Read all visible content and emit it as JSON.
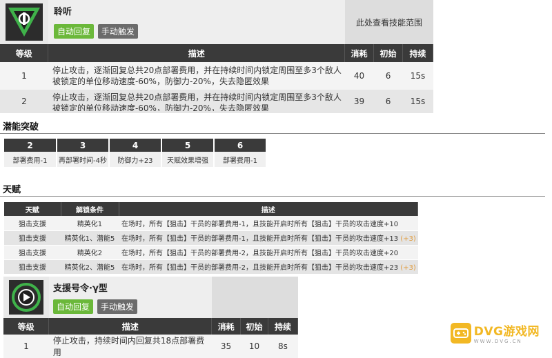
{
  "skill1": {
    "name": "聆听",
    "tags": [
      "自动回复",
      "手动触发"
    ],
    "range_label": "此处查看技能范围",
    "headers": [
      "等级",
      "描述",
      "消耗",
      "初始",
      "持续"
    ],
    "rows": [
      {
        "level": "1",
        "desc": "停止攻击，逐渐回复总共20点部署费用，并在持续时间内锁定周围至多3个敌人 被锁定的单位移动速度-60%，防御力-20%，失去隐匿效果",
        "cost": "40",
        "init": "6",
        "dur": "15s"
      },
      {
        "level": "2",
        "desc": "停止攻击，逐渐回复总共20点部署费用，并在持续时间内锁定周围至多3个敌人 被锁定的单位移动速度-60%，防御力-20%，失去隐匿效果",
        "cost": "39",
        "init": "6",
        "dur": "15s"
      }
    ]
  },
  "potential": {
    "title": "潜能突破",
    "headers": [
      "2",
      "3",
      "4",
      "5",
      "6"
    ],
    "values": [
      "部署费用-1",
      "再部署时间-4秒",
      "防御力+23",
      "天赋效果增强",
      "部署费用-1"
    ]
  },
  "talent": {
    "title": "天赋",
    "headers": [
      "天赋",
      "解锁条件",
      "描述"
    ],
    "rows": [
      {
        "name": "狙击支援",
        "cond": "精英化1",
        "desc": "在场时，所有【狙击】干员的部署费用-1，且技能开启时所有【狙击】干员的攻击速度+10",
        "extra": ""
      },
      {
        "name": "狙击支援",
        "cond": "精英化1、潜能5",
        "desc": "在场时，所有【狙击】干员的部署费用-1，且技能开启时所有【狙击】干员的攻击速度+13",
        "extra": "(+3)"
      },
      {
        "name": "狙击支援",
        "cond": "精英化2",
        "desc": "在场时，所有【狙击】干员的部署费用-2，且技能开启时所有【狙击】干员的攻击速度+20",
        "extra": ""
      },
      {
        "name": "狙击支援",
        "cond": "精英化2、潜能5",
        "desc": "在场时，所有【狙击】干员的部署费用-2，且技能开启时所有【狙击】干员的攻击速度+23",
        "extra": "(+3)"
      }
    ]
  },
  "skill2": {
    "name": "支援号令·γ型",
    "tags": [
      "自动回复",
      "手动触发"
    ],
    "headers": [
      "等级",
      "描述",
      "消耗",
      "初始",
      "持续"
    ],
    "rows": [
      {
        "level": "1",
        "desc": "停止攻击，持续时间内回复共18点部署费用",
        "cost": "35",
        "init": "10",
        "dur": "8s"
      }
    ]
  },
  "watermark": {
    "main": "DVG游戏网",
    "sub": "WWW.DVG.CN"
  },
  "colors": {
    "header_bg": "#3a3a3a",
    "tag_green": "#6bb83a",
    "tag_gray": "#6b6b6b",
    "accent_orange": "#e09a3a",
    "watermark": "#f2b824"
  },
  "icons": {
    "skill1": "triangle-skill-icon",
    "skill2": "circle-skill-icon",
    "watermark": "gamepad-icon"
  }
}
